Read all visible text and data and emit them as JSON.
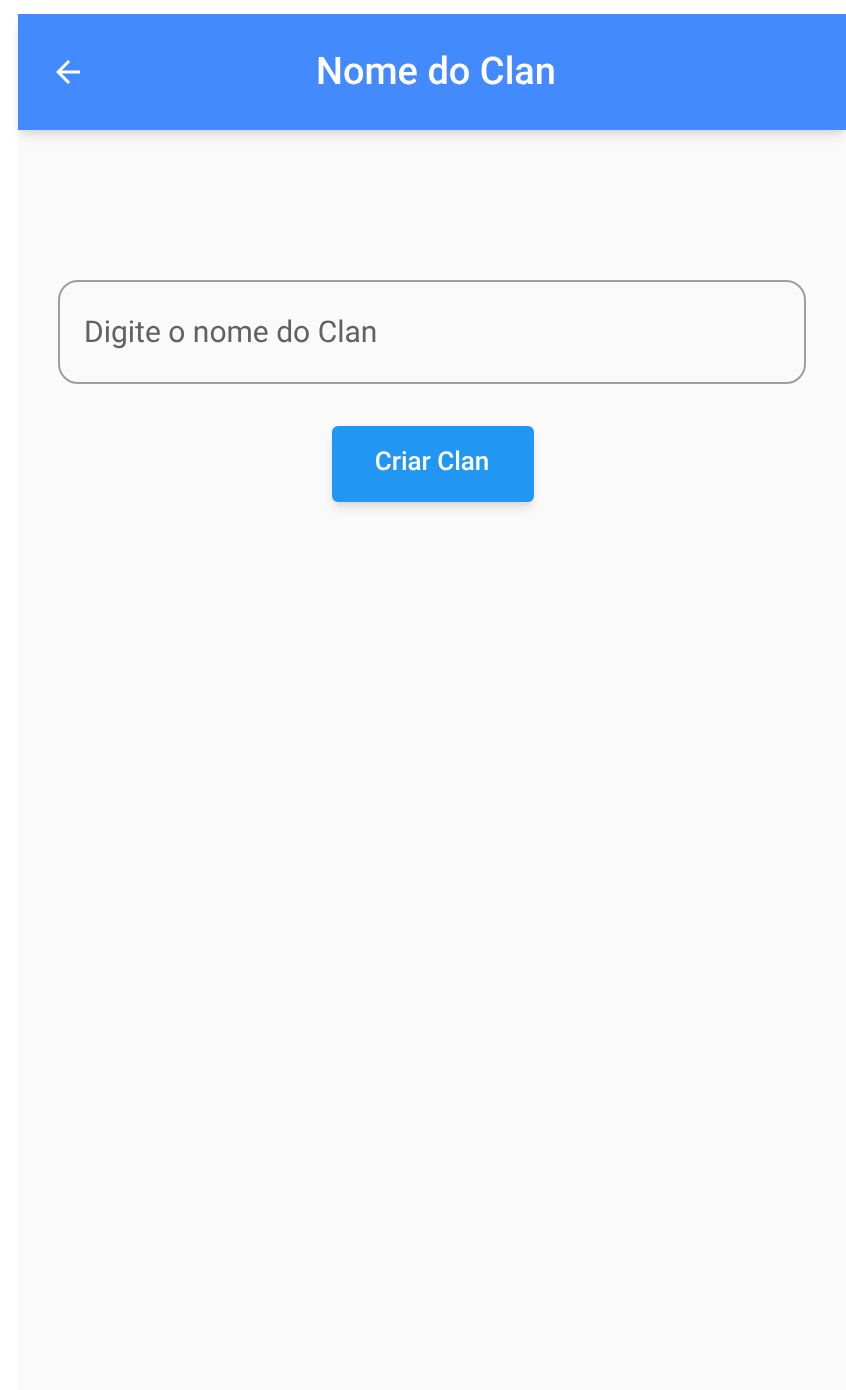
{
  "app_bar": {
    "title": "Nome do Clan"
  },
  "name_field": {
    "placeholder": "Digite o nome do Clan"
  },
  "create_button": {
    "label": "Criar Clan"
  }
}
